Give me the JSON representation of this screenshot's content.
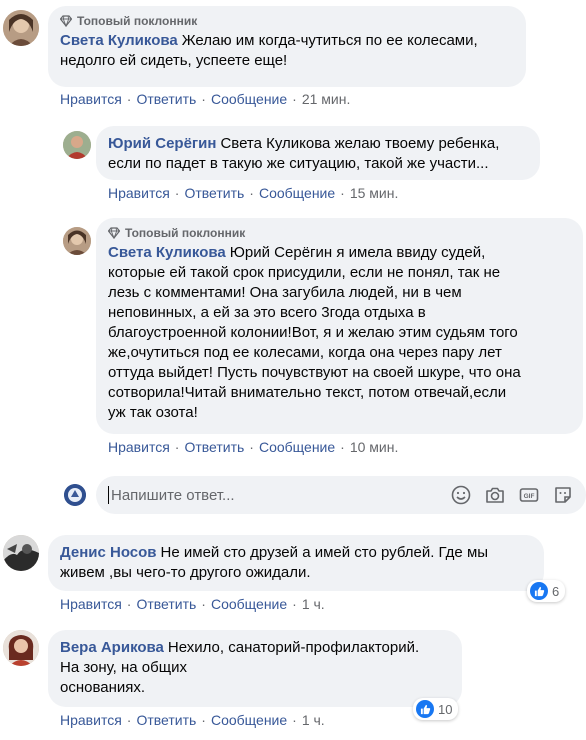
{
  "actions": {
    "like": "Нравится",
    "reply": "Ответить",
    "message": "Сообщение",
    "separator": "·"
  },
  "badge_label": "Топовый поклонник",
  "comments": [
    {
      "author": "Света Куликова",
      "text_lines": [
        "Желаю им когда-чутиться по ее колесами,",
        "недолго ей сидеть, успеете еще!"
      ],
      "time": "21 мин.",
      "badge": true
    },
    {
      "author": "Юрий Серёгин",
      "text_lines": [
        "Света Куликова желаю твоему ребенка,",
        "если по падет в такую же ситуацию, такой же участи..."
      ],
      "time": "15 мин.",
      "badge": false
    },
    {
      "author": "Света Куликова",
      "text_lines": [
        "Юрий Серёгин я имела ввиду судей,",
        "которые ей такой срок присудили, если не понял, так не",
        "лезь с комментами! Она загубила людей, ни в чем",
        "неповинных, а ей за это всего 3года отдыха в",
        "благоустроенной колонии!Вот, я и желаю этим судьям того",
        "же,очутиться под ее колесами, когда она через пару лет",
        "оттуда выйдет! Пусть почувствуют на своей шкуре, что она",
        "сотворила!Читай внимательно текст, потом отвечай,если",
        "уж так озота!"
      ],
      "time": "10 мин.",
      "badge": true
    },
    {
      "author": "Денис Носов",
      "text_lines": [
        "Не имей сто друзей а имей сто рублей. Где мы",
        "живем ,вы чего-то другого ожидали."
      ],
      "time": "1 ч.",
      "badge": false,
      "likes": "6"
    },
    {
      "author": "Вера Арикова",
      "text_lines": [
        "Нехило, санаторий-профилакторий.",
        "На зону, на общих",
        "основаниях."
      ],
      "time": "1 ч.",
      "badge": false,
      "likes": "10"
    }
  ],
  "reply_input": {
    "placeholder": "Напишите ответ..."
  },
  "colors": {
    "link": "#385898",
    "bubble": "#f0f2f5",
    "meta": "#65676b",
    "like_blue": "#1877f2"
  },
  "icons": [
    "diamond-icon",
    "like-icon",
    "emoji-icon",
    "camera-icon",
    "gif-icon",
    "sticker-icon"
  ]
}
